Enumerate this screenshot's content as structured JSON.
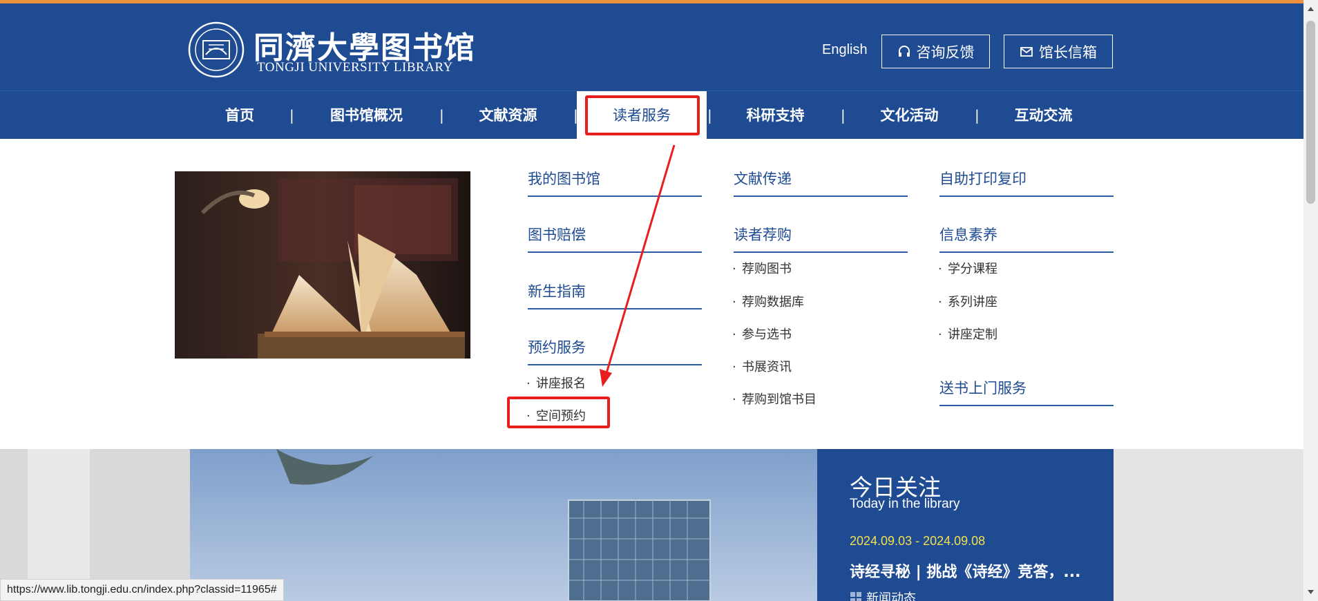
{
  "colors": {
    "brand": "#1f4b93",
    "accent": "#f0913f",
    "highlight": "#f4e04d",
    "annotation": "#e81d1d"
  },
  "header": {
    "logo_cn": "同濟大學图书馆",
    "logo_en": "TONGJI UNIVERSITY LIBRARY",
    "lang_link": "English",
    "consult_button": "咨询反馈",
    "consult_icon": "headset-icon",
    "mail_button": "馆长信箱",
    "mail_icon": "envelope-icon"
  },
  "nav": {
    "separator": "|",
    "items": [
      "首页",
      "图书馆概况",
      "文献资源",
      "读者服务",
      "科研支持",
      "文化活动",
      "互动交流"
    ],
    "active_index": 3
  },
  "dropdown": {
    "col1": {
      "my_library": "我的图书馆",
      "compensation": "图书赔偿",
      "freshman": "新生指南",
      "booking": "预约服务",
      "booking_items": [
        "讲座报名",
        "空间预约"
      ]
    },
    "col2": {
      "delivery": "文献传递",
      "recommend": "读者荐购",
      "recommend_items": [
        "荐购图书",
        "荐购数据库",
        "参与选书",
        "书展资讯",
        "荐购到馆书目"
      ]
    },
    "col3": {
      "self_print": "自助打印复印",
      "literacy": "信息素养",
      "literacy_items": [
        "学分课程",
        "系列讲座",
        "讲座定制"
      ],
      "door_delivery": "送书上门服务"
    }
  },
  "today": {
    "title": "今日关注",
    "subtitle": "Today in the library",
    "date": "2024.09.03 - 2024.09.08",
    "headline": "诗经寻秘 | 挑战《诗经》竞答，...",
    "news_label": "新闻动态"
  },
  "status_url": "https://www.lib.tongji.edu.cn/index.php?classid=11965#"
}
